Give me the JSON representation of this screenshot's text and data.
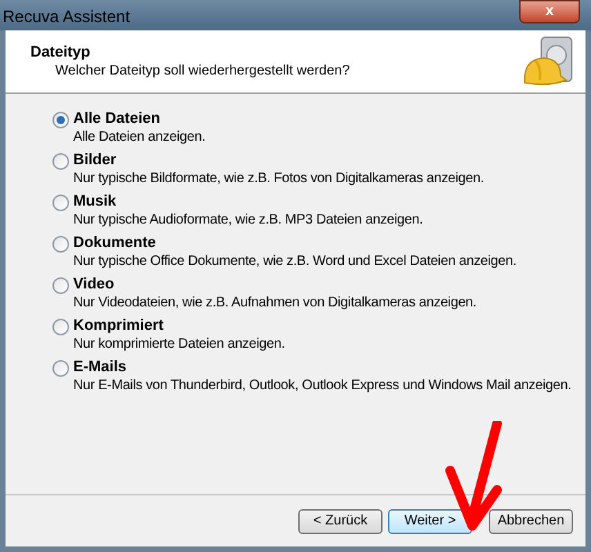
{
  "window": {
    "title": "Recuva Assistent",
    "close_button": "x"
  },
  "header": {
    "title": "Dateityp",
    "subtitle": "Welcher Dateityp soll wiederhergestellt werden?"
  },
  "options": [
    {
      "label": "Alle Dateien",
      "description": "Alle Dateien anzeigen.",
      "selected": true
    },
    {
      "label": "Bilder",
      "description": "Nur typische Bildformate, wie z.B. Fotos von Digitalkameras anzeigen.",
      "selected": false
    },
    {
      "label": "Musik",
      "description": "Nur typische Audioformate, wie z.B. MP3 Dateien anzeigen.",
      "selected": false
    },
    {
      "label": "Dokumente",
      "description": "Nur typische Office Dokumente, wie z.B. Word und Excel Dateien anzeigen.",
      "selected": false
    },
    {
      "label": "Video",
      "description": "Nur Videodateien, wie z.B. Aufnahmen von Digitalkameras anzeigen.",
      "selected": false
    },
    {
      "label": "Komprimiert",
      "description": "Nur komprimierte Dateien anzeigen.",
      "selected": false
    },
    {
      "label": "E-Mails",
      "description": "Nur E-Mails von Thunderbird, Outlook, Outlook Express und Windows Mail anzeigen.",
      "selected": false
    }
  ],
  "buttons": [
    {
      "label": "< Zurück",
      "focused": false
    },
    {
      "label": "Weiter >",
      "focused": true
    },
    {
      "label": "Abbrechen",
      "focused": false
    }
  ]
}
